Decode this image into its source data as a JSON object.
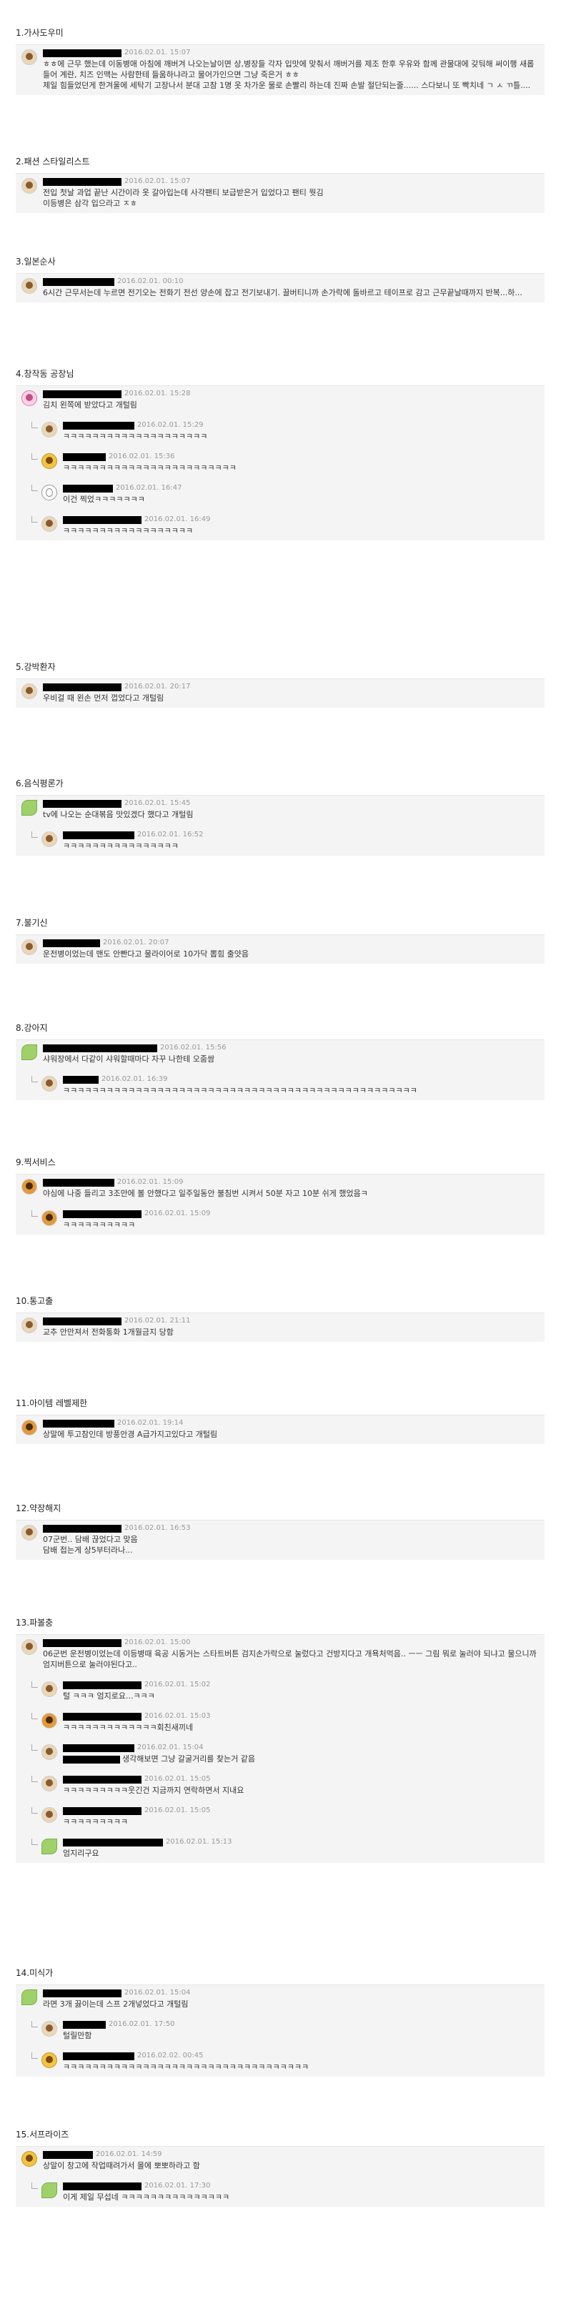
{
  "sections": [
    {
      "title": "1.가사도우미",
      "comments": [
        {
          "date": "2016.02.01. 15:07",
          "text": "ㅎㅎ에 근무 했는데 이동병애 아침에 깨버겨 나오는날이면 상,병장들 각자 입맛에 맞춰서 깨버거를 제조 한후 우유와 함께 관물대에 갖둬해 써이행 새롭들어 계란, 치즈 인맥는 사람한테 들움하냐라고 물어가인으면 그냥 죽은거 ㅎㅎ\n제일 힘들었던게 한겨울에 세탁기 고장나서 분대 고참 1명 옷 차가운 물로 손빨리 하는데 진짜 손발 절단되는줄...... 스다보니 또 빡치네 ㄱ ㅅ ㄲ틀....",
          "replies": []
        }
      ]
    },
    {
      "title": "2.패션 스타일리스트",
      "comments": [
        {
          "date": "2016.02.01. 15:07",
          "text": "전입 첫날 과업 끝난 시간이라 옷 갈아입는데 사각팬티 보급받은거 입었다고 팬티 뭣김\n이등병은 삼각 입으라고 ㅈㅎ",
          "replies": []
        }
      ]
    },
    {
      "title": "3.일본순사",
      "comments": [
        {
          "date": "2016.02.01. 00:10",
          "text": "6시간 근무서는데 누르면 전기오는 전화기 전선 양손에 잡고 전기보내기. 끌버티니까 손가락에 돌바르고 테이프로 감고 근무끝날때까지 반복...하...",
          "replies": []
        }
      ]
    },
    {
      "title": "4.창작동 공장님",
      "comments": [
        {
          "date": "2016.02.01. 15:28",
          "text": "김치 왼쪽에 받았다고 개털림",
          "replies": [
            {
              "date": "2016.02.01. 15:29",
              "text": "ㅋㅋㅋㅋㅋㅋㅋㅋㅋㅋㅋㅋㅋㅋㅋㅋㅋㅋㅋㅋ"
            },
            {
              "date": "2016.02.01. 15:36",
              "text": "ㅋㅋㅋㅋㅋㅋㅋㅋㅋㅋㅋㅋㅋㅋㅋㅋㅋㅋㅋㅋㅋㅋㅋㅋ"
            },
            {
              "date": "2016.02.01. 16:47",
              "text": "이건 찍었ㅋㅋㅋㅋㅋㅋㅋ"
            },
            {
              "date": "2016.02.01. 16:49",
              "text": "ㅋㅋㅋㅋㅋㅋㅋㅋㅋㅋㅋㅋㅋㅋㅋㅋㅋㅋ"
            }
          ]
        }
      ]
    },
    {
      "title": "5.강박환자",
      "comments": [
        {
          "date": "2016.02.01. 20:17",
          "text": "우비걸 때 왼손 먼저 껍었다고 개털림",
          "replies": []
        }
      ]
    },
    {
      "title": "6.음식평론가",
      "comments": [
        {
          "date": "2016.02.01. 15:45",
          "text": "tv에 나오는 순대볶음 맛있겠다 했다고 개털림",
          "replies": [
            {
              "date": "2016.02.01. 16:52",
              "text": "ㅋㅋㅋㅋㅋㅋㅋㅋㅋㅋㅋㅋㅋㅋㅋㅋ"
            }
          ]
        }
      ]
    },
    {
      "title": "7.불기신",
      "comments": [
        {
          "date": "2016.02.01. 20:07",
          "text": "운전병이었는데 맨도 안빤다고 물라이어로 10가닥 뽑힘 출얏음",
          "replies": []
        }
      ]
    },
    {
      "title": "8.강아지",
      "comments": [
        {
          "date": "2016.02.01. 15:56",
          "text": "샤워장에서 다같이 샤워할때마다 자꾸 나한테 오줌쌈",
          "replies": [
            {
              "date": "2016.02.01. 16:39",
              "text": "ㅋㅋㅋㅋㅋㅋㅋㅋㅋㅋㅋㅋㅋㅋㅋㅋㅋㅋㅋㅋㅋㅋㅋㅋㅋㅋㅋㅋㅋㅋㅋㅋㅋㅋㅋㅋㅋㅋㅋㅋㅋㅋㅋㅋㅋㅋㅋㅋㅋ"
            }
          ]
        }
      ]
    },
    {
      "title": "9.찍서비스",
      "comments": [
        {
          "date": "2016.02.01. 15:09",
          "text": "야심에 나중 들리고 3조만에 볼 안했다고 일주일동안 불침번 시켜서 50분 자고 10분 쉬게 했었음ㅋ",
          "replies": [
            {
              "date": "2016.02.01. 15:09",
              "text": "ㅋㅋㅋㅋㅋㅋㅋㅋㅋㅋ"
            }
          ]
        }
      ]
    },
    {
      "title": "10.통고출",
      "comments": [
        {
          "date": "2016.02.01. 21:11",
          "text": "교추 안만져서 전화통화 1개월금지 당함",
          "replies": []
        }
      ]
    },
    {
      "title": "11.아이템 레벨제한",
      "comments": [
        {
          "date": "2016.02.01. 19:14",
          "text": "상말에 투고참인데 방풍안경 A급가지고있다고 개털림",
          "replies": []
        }
      ]
    },
    {
      "title": "12.약장해지",
      "comments": [
        {
          "date": "2016.02.01. 16:53",
          "text": "07군번.. 담배 끊었다고 맞음\n담배 접는게 상5부터라나...",
          "replies": []
        }
      ]
    },
    {
      "title": "13.파볼충",
      "comments": [
        {
          "date": "2016.02.01. 15:00",
          "text": "06군번 운전병이었는데 이등병때 육공 시동거는 스타트버튼 검지손가락으로 눌렀다고 건방지다고 개욕처먹음.. ㅡㅡ 그림 뭐로 눌러야 되냐고 물으니까 엄지버튼으로 눌러야된다고..",
          "replies": [
            {
              "date": "2016.02.01. 15:02",
              "text": "털 ㅋㅋㅋ 엄지로요...ㅋㅋㅋ"
            },
            {
              "date": "2016.02.01. 15:03",
              "text": "ㅋㅋㅋㅋㅋㅋㅋㅋㅋㅋㅋㅋㅋ회친새끼네"
            },
            {
              "date": "2016.02.01. 15:04",
              "text": "생각해보면 그냥 갈굴거리를 찾는거 같음"
            },
            {
              "date": "2016.02.01. 15:05",
              "text": "ㅋㅋㅋㅋㅋㅋㅋㅋㅋ웃긴건 지금까지 연락하면서 지내요"
            },
            {
              "date": "2016.02.01. 15:05",
              "text": "ㅋㅋㅋㅋㅋㅋㅋㅋㅋ"
            },
            {
              "date": "2016.02.01. 15:13",
              "text": "엄지리구요"
            }
          ]
        }
      ]
    },
    {
      "title": "14.미식가",
      "comments": [
        {
          "date": "2016.02.01. 15:04",
          "text": "라면 3개 끓이는데 스프 2개넣었다고 개털림",
          "replies": [
            {
              "date": "2016.02.01. 17:50",
              "text": "털릴만함"
            },
            {
              "date": "2016.02.02. 00:45",
              "text": "ㅋㅋㅋㅋㅋㅋㅋㅋㅋㅋㅋㅋㅋㅋㅋㅋㅋㅋㅋㅋㅋㅋㅋㅋㅋㅋㅋㅋㅋㅋㅋㅋㅋㅋ"
            }
          ]
        }
      ]
    },
    {
      "title": "15.서프라이즈",
      "comments": [
        {
          "date": "2016.02.01. 14:59",
          "text": "상말이 창고에 작업때려가서 몰에 뽀뽀하라고 함",
          "replies": [
            {
              "date": "2016.02.01. 17:30",
              "text": "이게 제일 무섭네 ㅋㅋㅋㅋㅋㅋㅋㅋㅋㅋㅋㅋㅋㅋㅋ"
            }
          ]
        }
      ]
    }
  ]
}
